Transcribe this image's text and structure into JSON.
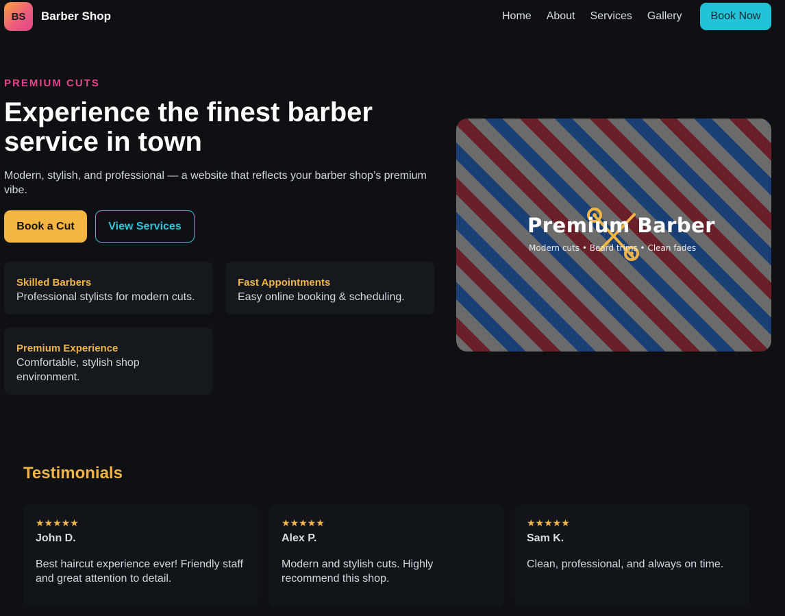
{
  "nav": {
    "logo_initials": "BS",
    "brand": "Barber Shop",
    "links": [
      "Home",
      "About",
      "Services",
      "Gallery"
    ],
    "cta": "Book Now"
  },
  "hero": {
    "eyebrow": "PREMIUM CUTS",
    "title": "Experience the finest barber service in town",
    "subtitle": "Modern, stylish, and professional — a website that reflects your barber shop’s premium vibe.",
    "primary_button": "Book a Cut",
    "secondary_button": "View Services",
    "features": [
      {
        "title": "Skilled Barbers",
        "desc": "Professional stylists for modern cuts."
      },
      {
        "title": "Fast Appointments",
        "desc": "Easy online booking & scheduling."
      },
      {
        "title": "Premium Experience",
        "desc": "Comfortable, stylish shop environment."
      }
    ],
    "image": {
      "title": "Premium Barber",
      "subtitle": "Modern cuts • Beard trims • Clean fades",
      "icon": "scissors-icon"
    }
  },
  "testimonials": {
    "heading": "Testimonials",
    "items": [
      {
        "stars": "★★★★★",
        "rating": 5,
        "name": "John D.",
        "quote": "Best haircut experience ever! Friendly staff and great attention to detail."
      },
      {
        "stars": "★★★★★",
        "rating": 5,
        "name": "Alex P.",
        "quote": "Modern and stylish cuts. Highly recommend this shop."
      },
      {
        "stars": "★★★★★",
        "rating": 5,
        "name": "Sam K.",
        "quote": "Clean, professional, and always on time."
      }
    ]
  },
  "colors": {
    "background": "#0e1013",
    "accent_gold": "#f2b444",
    "accent_cyan": "#22c3d8",
    "accent_pink": "#e5428f"
  }
}
